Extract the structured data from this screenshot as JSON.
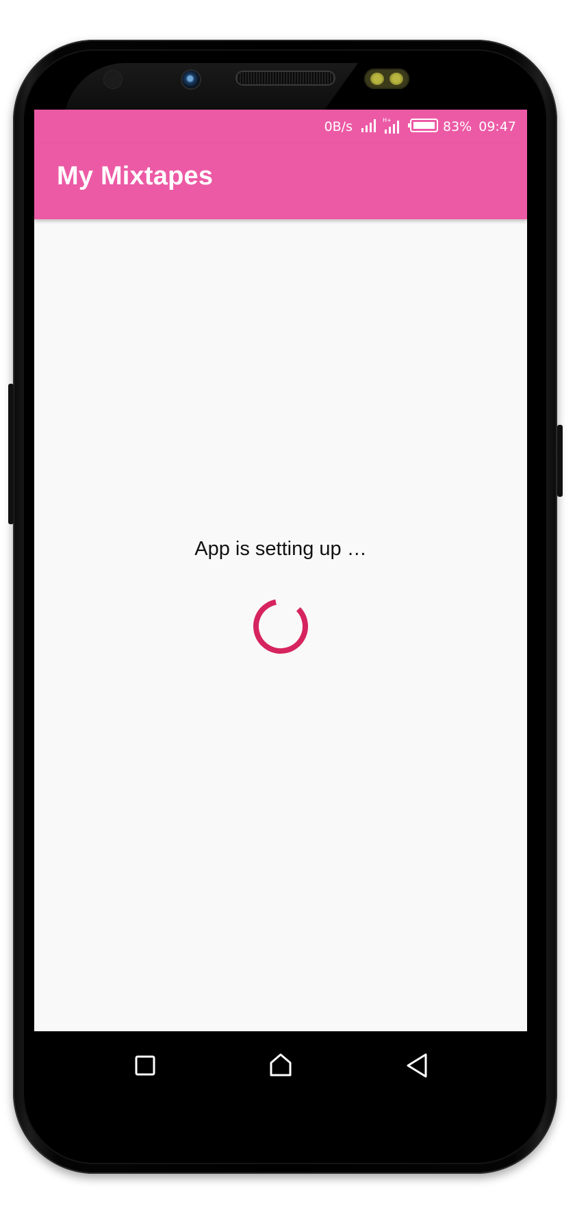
{
  "status_bar": {
    "speed": "0B/s",
    "battery_percent": "83%",
    "time": "09:47",
    "icons": [
      "signal-icon",
      "signal-hplus-icon",
      "battery-icon"
    ]
  },
  "app_bar": {
    "title": "My Mixtapes"
  },
  "main": {
    "loading_text": "App is setting up …",
    "spinner_icon": "progress-spinner-icon",
    "spinner_color": "#d6245f"
  },
  "nav_bar": {
    "buttons": [
      "recents-square-icon",
      "home-icon",
      "back-triangle-icon"
    ]
  },
  "colors": {
    "primary": "#ec5aa5",
    "background": "#f9f9f9",
    "accent": "#d6245f"
  }
}
